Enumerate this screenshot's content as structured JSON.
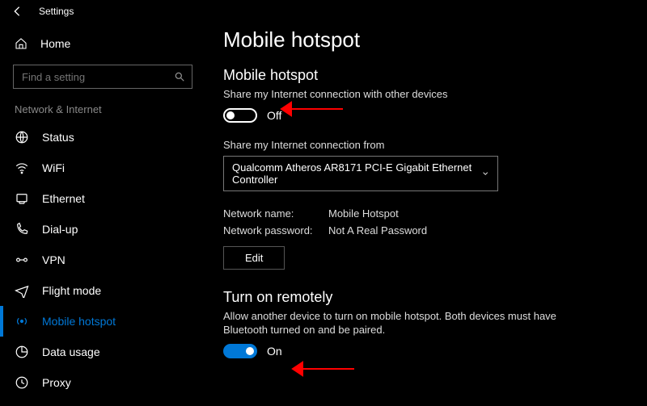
{
  "app": {
    "title": "Settings"
  },
  "sidebar": {
    "home": "Home",
    "search_placeholder": "Find a setting",
    "group": "Network & Internet",
    "items": [
      {
        "label": "Status"
      },
      {
        "label": "WiFi"
      },
      {
        "label": "Ethernet"
      },
      {
        "label": "Dial-up"
      },
      {
        "label": "VPN"
      },
      {
        "label": "Flight mode"
      },
      {
        "label": "Mobile hotspot"
      },
      {
        "label": "Data usage"
      },
      {
        "label": "Proxy"
      }
    ]
  },
  "page": {
    "title": "Mobile hotspot",
    "hotspot": {
      "heading": "Mobile hotspot",
      "desc": "Share my Internet connection with other devices",
      "toggle_label": "Off"
    },
    "share_from": {
      "label": "Share my Internet connection from",
      "value": "Qualcomm Atheros AR8171 PCI-E Gigabit Ethernet Controller"
    },
    "network": {
      "name_label": "Network name:",
      "name_value": "Mobile Hotspot",
      "pw_label": "Network password:",
      "pw_value": "Not A Real Password",
      "edit": "Edit"
    },
    "remote": {
      "heading": "Turn on remotely",
      "desc": "Allow another device to turn on mobile hotspot. Both devices must have Bluetooth turned on and be paired.",
      "toggle_label": "On"
    }
  },
  "colors": {
    "accent": "#0078d7",
    "annotation": "#ff0000"
  }
}
